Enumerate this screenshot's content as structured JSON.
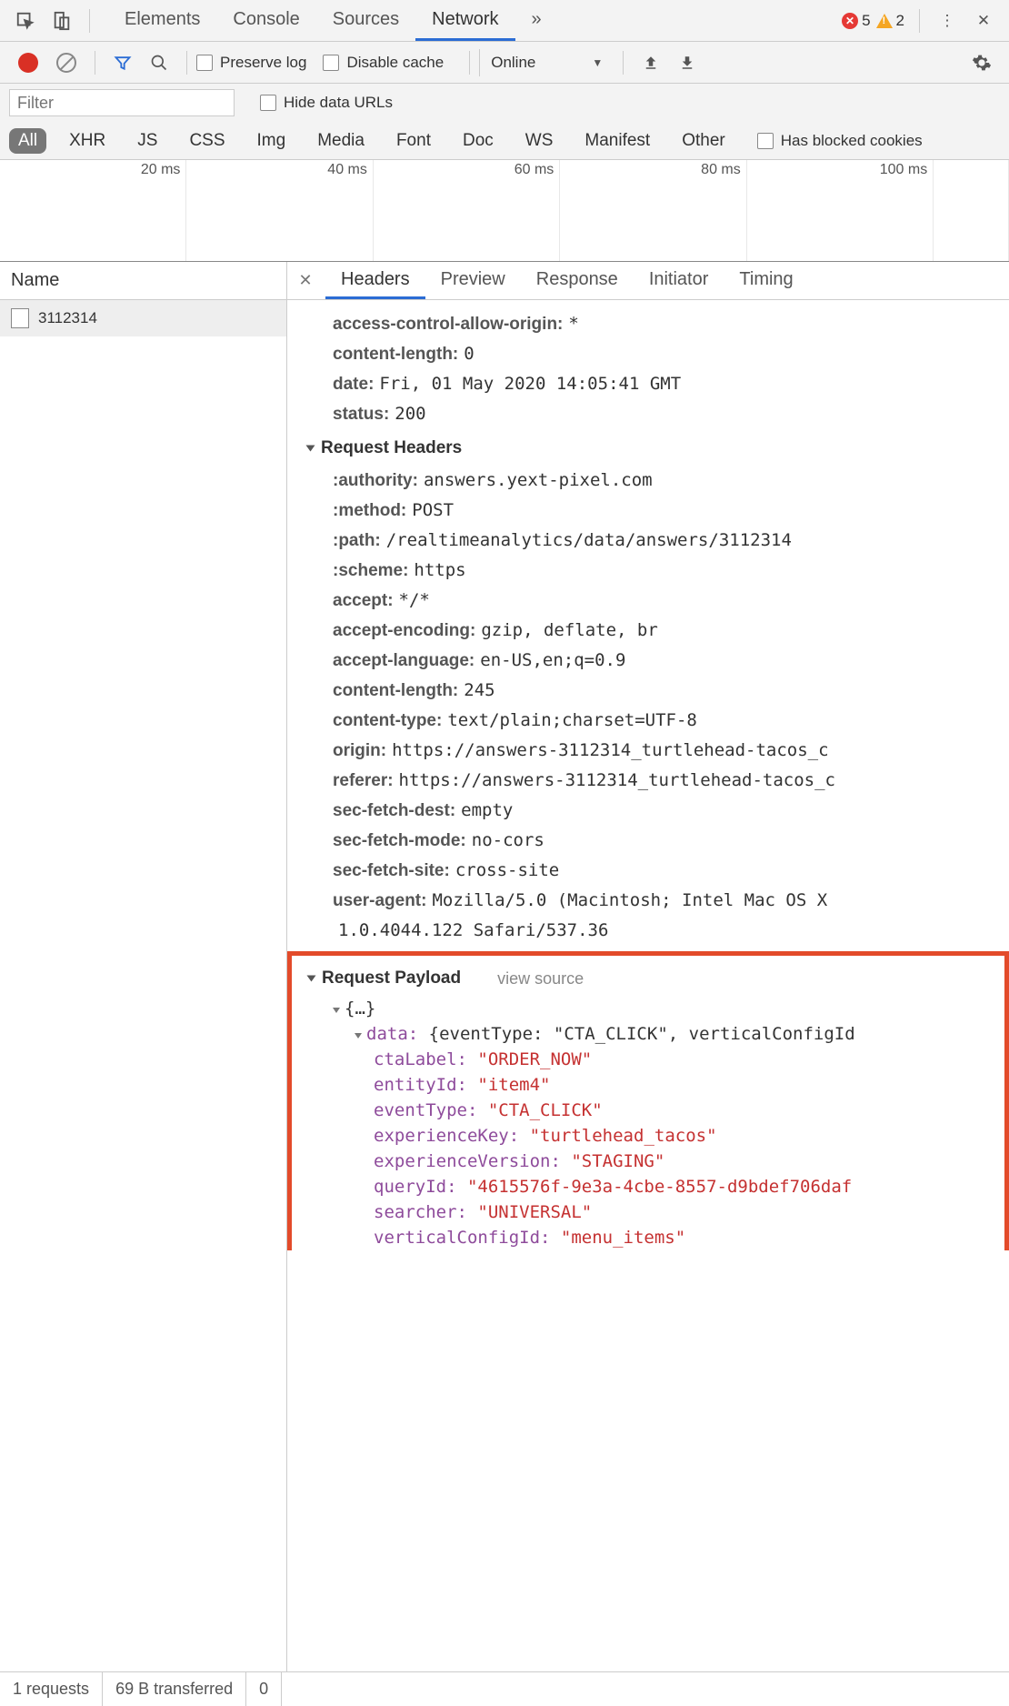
{
  "topTabs": [
    "Elements",
    "Console",
    "Sources",
    "Network"
  ],
  "activeTopTab": "Network",
  "errors": "5",
  "warnings": "2",
  "preserveLog": "Preserve log",
  "disableCache": "Disable cache",
  "throttle": "Online",
  "filterPlaceholder": "Filter",
  "hideDataURLs": "Hide data URLs",
  "types": [
    "All",
    "XHR",
    "JS",
    "CSS",
    "Img",
    "Media",
    "Font",
    "Doc",
    "WS",
    "Manifest",
    "Other"
  ],
  "hasBlocked": "Has blocked cookies",
  "timelineTicks": [
    "20 ms",
    "40 ms",
    "60 ms",
    "80 ms",
    "100 ms"
  ],
  "nameHeader": "Name",
  "requestItem": "3112314",
  "detailTabs": [
    "Headers",
    "Preview",
    "Response",
    "Initiator",
    "Timing"
  ],
  "activeDetailTab": "Headers",
  "responseHeaders": [
    {
      "k": "access-control-allow-origin:",
      "v": "*"
    },
    {
      "k": "content-length:",
      "v": "0"
    },
    {
      "k": "date:",
      "v": "Fri, 01 May 2020 14:05:41 GMT"
    },
    {
      "k": "status:",
      "v": "200"
    }
  ],
  "requestHeadersTitle": "Request Headers",
  "requestHeaders": [
    {
      "k": ":authority:",
      "v": "answers.yext-pixel.com"
    },
    {
      "k": ":method:",
      "v": "POST"
    },
    {
      "k": ":path:",
      "v": "/realtimeanalytics/data/answers/3112314"
    },
    {
      "k": ":scheme:",
      "v": "https"
    },
    {
      "k": "accept:",
      "v": "*/*"
    },
    {
      "k": "accept-encoding:",
      "v": "gzip, deflate, br"
    },
    {
      "k": "accept-language:",
      "v": "en-US,en;q=0.9"
    },
    {
      "k": "content-length:",
      "v": "245"
    },
    {
      "k": "content-type:",
      "v": "text/plain;charset=UTF-8"
    },
    {
      "k": "origin:",
      "v": "https://answers-3112314_turtlehead-tacos_c"
    },
    {
      "k": "referer:",
      "v": "https://answers-3112314_turtlehead-tacos_c"
    },
    {
      "k": "sec-fetch-dest:",
      "v": "empty"
    },
    {
      "k": "sec-fetch-mode:",
      "v": "no-cors"
    },
    {
      "k": "sec-fetch-site:",
      "v": "cross-site"
    },
    {
      "k": "user-agent:",
      "v": "Mozilla/5.0 (Macintosh; Intel Mac OS X"
    },
    {
      "k": "",
      "v": "1.0.4044.122 Safari/537.36"
    }
  ],
  "payloadTitle": "Request Payload",
  "viewSource": "view source",
  "payloadRoot": "{…}",
  "payloadDataLine": "{eventType: \"CTA_CLICK\", verticalConfigId",
  "payloadDataKey": "data:",
  "payload": [
    {
      "k": "ctaLabel:",
      "v": "\"ORDER_NOW\""
    },
    {
      "k": "entityId:",
      "v": "\"item4\""
    },
    {
      "k": "eventType:",
      "v": "\"CTA_CLICK\""
    },
    {
      "k": "experienceKey:",
      "v": "\"turtlehead_tacos\""
    },
    {
      "k": "experienceVersion:",
      "v": "\"STAGING\""
    },
    {
      "k": "queryId:",
      "v": "\"4615576f-9e3a-4cbe-8557-d9bdef706daf"
    },
    {
      "k": "searcher:",
      "v": "\"UNIVERSAL\""
    },
    {
      "k": "verticalConfigId:",
      "v": "\"menu_items\""
    }
  ],
  "status": {
    "requests": "1 requests",
    "transferred": "69 B transferred",
    "resources": "0"
  }
}
